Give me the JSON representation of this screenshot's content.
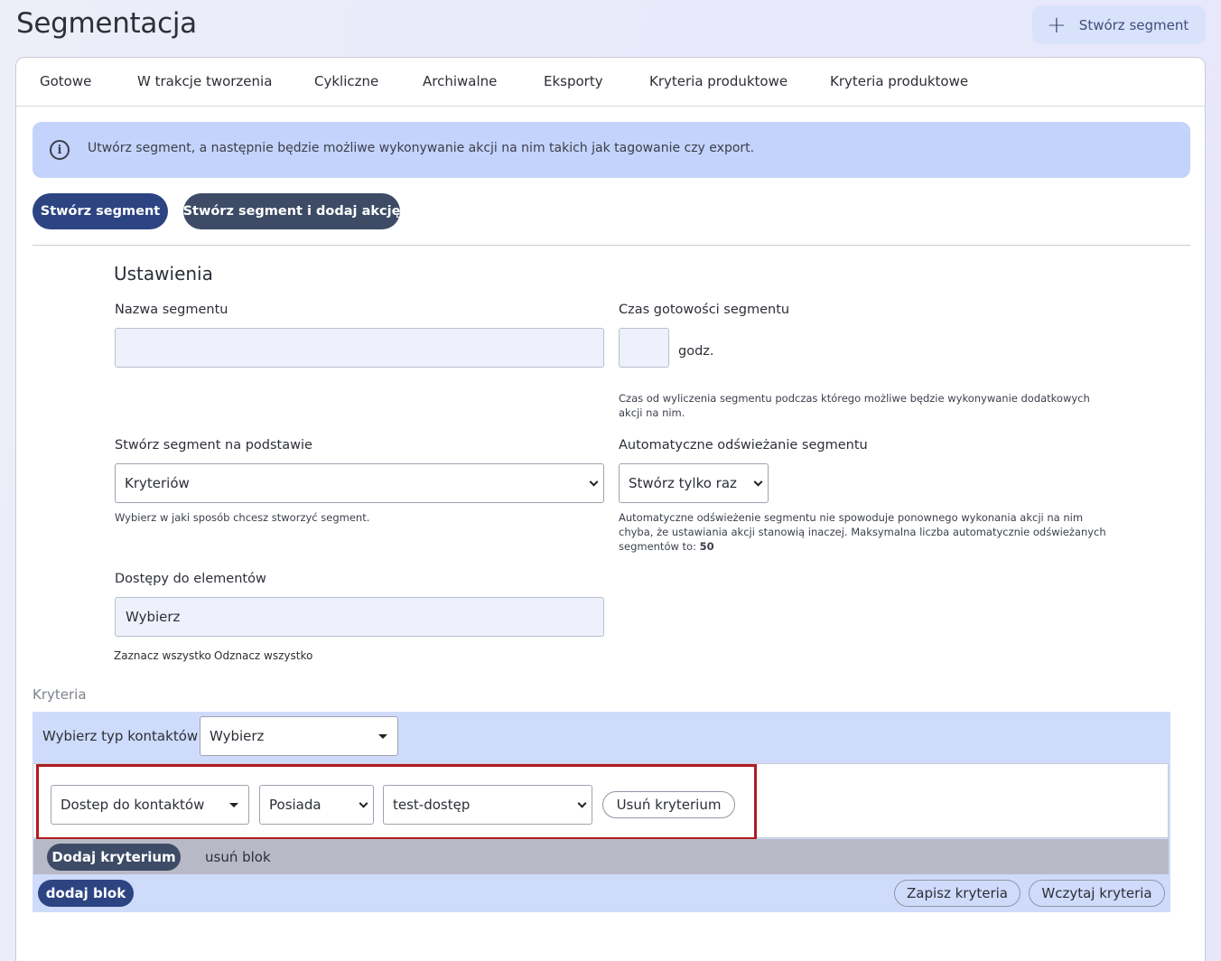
{
  "header": {
    "title": "Segmentacja",
    "create_button_label": "Stwórz segment"
  },
  "tabs": [
    {
      "label": "Gotowe"
    },
    {
      "label": "W trakcje tworzenia"
    },
    {
      "label": "Cykliczne"
    },
    {
      "label": "Archiwalne"
    },
    {
      "label": "Eksporty"
    },
    {
      "label": "Kryteria produktowe"
    },
    {
      "label": "Kryteria produktowe"
    }
  ],
  "info": {
    "text": "Utwórz segment, a następnie będzie możliwe wykonywanie akcji na nim takich jak tagowanie czy export."
  },
  "actions": {
    "create_label": "Stwórz segment",
    "create_and_add_label": "Stwórz segment i dodaj akcję"
  },
  "settings": {
    "title": "Ustawienia",
    "name_label": "Nazwa segmentu",
    "name_value": "",
    "ready_time_label": "Czas gotowości segmentu",
    "ready_time_value": "",
    "ready_time_unit": "godz.",
    "ready_time_help": "Czas od wyliczenia segmentu podczas którego możliwe będzie wykonywanie dodatkowych akcji na nim.",
    "basis_label": "Stwórz segment na podstawie",
    "basis_value": "Kryteriów",
    "basis_help": "Wybierz w jaki sposób chcesz stworzyć segment.",
    "refresh_label": "Automatyczne odświeżanie segmentu",
    "refresh_value": "Stwórz tylko raz",
    "refresh_help": "Automatyczne odświeżenie segmentu nie spowoduje ponownego wykonania akcji na nim chyba, że ustawiania akcji stanowią inaczej. Maksymalna liczba automatycznie odświeżanych segmentów to:",
    "refresh_max": "50",
    "access_label": "Dostępy do elementów",
    "access_value": "Wybierz",
    "select_all": "Zaznacz wszystko",
    "deselect_all": "Odznacz wszystko"
  },
  "criteria": {
    "section_label": "Kryteria",
    "contact_type_label": "Wybierz typ kontaktów",
    "contact_type_value": "Wybierz",
    "row": {
      "field_value": "Dostep do kontaktów",
      "operator_value": "Posiada",
      "target_value": "test-dostęp",
      "remove_label": "Usuń kryterium"
    },
    "add_criterion_label": "Dodaj kryterium",
    "remove_block_label": "usuń blok",
    "add_block_label": "dodaj blok",
    "save_label": "Zapisz kryteria",
    "load_label": "Wczytaj kryteria"
  },
  "colors": {
    "primary": "#2d4483",
    "secondary": "#3d4b66",
    "info_bg": "#c4d3fb",
    "highlight": "#b01c24"
  }
}
